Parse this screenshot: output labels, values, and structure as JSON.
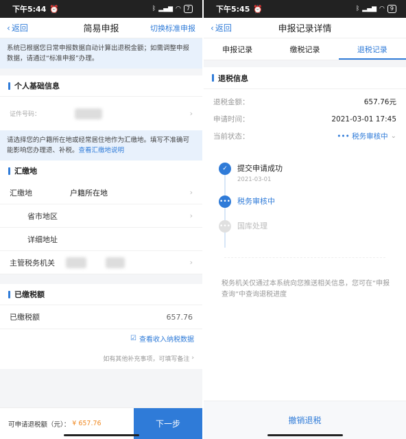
{
  "left": {
    "status": {
      "time": "下午5:44",
      "battery": "7"
    },
    "nav": {
      "back": "返回",
      "title": "简易申报",
      "right": "切换标准申报"
    },
    "notice": "系统已根据您日常申报数据自动计算出退税金额；如需调整申报数据，请通过“标准申报”办理。",
    "personal": {
      "title": "个人基础信息",
      "id_label": "证件号码："
    },
    "hint": {
      "text": "请选择您的户籍所在地或经常居住地作为汇缴地。填写不准确可能影响您办理退、补税。",
      "link": "查看汇缴地说明"
    },
    "hj": {
      "title": "汇缴地",
      "rows": [
        {
          "label": "汇缴地",
          "value": "户籍所在地"
        },
        {
          "label": "省市地区",
          "value": ""
        },
        {
          "label": "详细地址",
          "value": ""
        },
        {
          "label": "主管税务机关",
          "value": ""
        }
      ]
    },
    "paid": {
      "title": "已缴税额",
      "label": "已缴税额",
      "value": "657.76",
      "link": "查看收入纳税数据",
      "remark": "如有其他补充事项，可填写备注"
    },
    "bottom": {
      "label": "可申请退税额（元）：",
      "amount": "¥ 657.76",
      "button": "下一步"
    }
  },
  "right": {
    "status": {
      "time": "下午5:45",
      "battery": "9"
    },
    "nav": {
      "back": "返回",
      "title": "申报记录详情"
    },
    "tabs": [
      "申报记录",
      "缴税记录",
      "退税记录"
    ],
    "info": {
      "title": "退税信息",
      "amount_label": "退税金额：",
      "amount": "657.76元",
      "time_label": "申请时间：",
      "time": "2021-03-01 17:45",
      "state_label": "当前状态：",
      "state": "••• 税务审核中"
    },
    "timeline": [
      {
        "title": "提交申请成功",
        "date": "2021-03-01"
      },
      {
        "title": "税务审核中",
        "date": ""
      },
      {
        "title": "国库处理",
        "date": ""
      }
    ],
    "footnote": "税务机关仅通过本系统向您推送相关信息，您可在“申报查询”中查询退税进度",
    "bottom_button": "撤销退税"
  },
  "colors": {
    "accent": "#2f7bd8",
    "amount": "#f08a24"
  }
}
